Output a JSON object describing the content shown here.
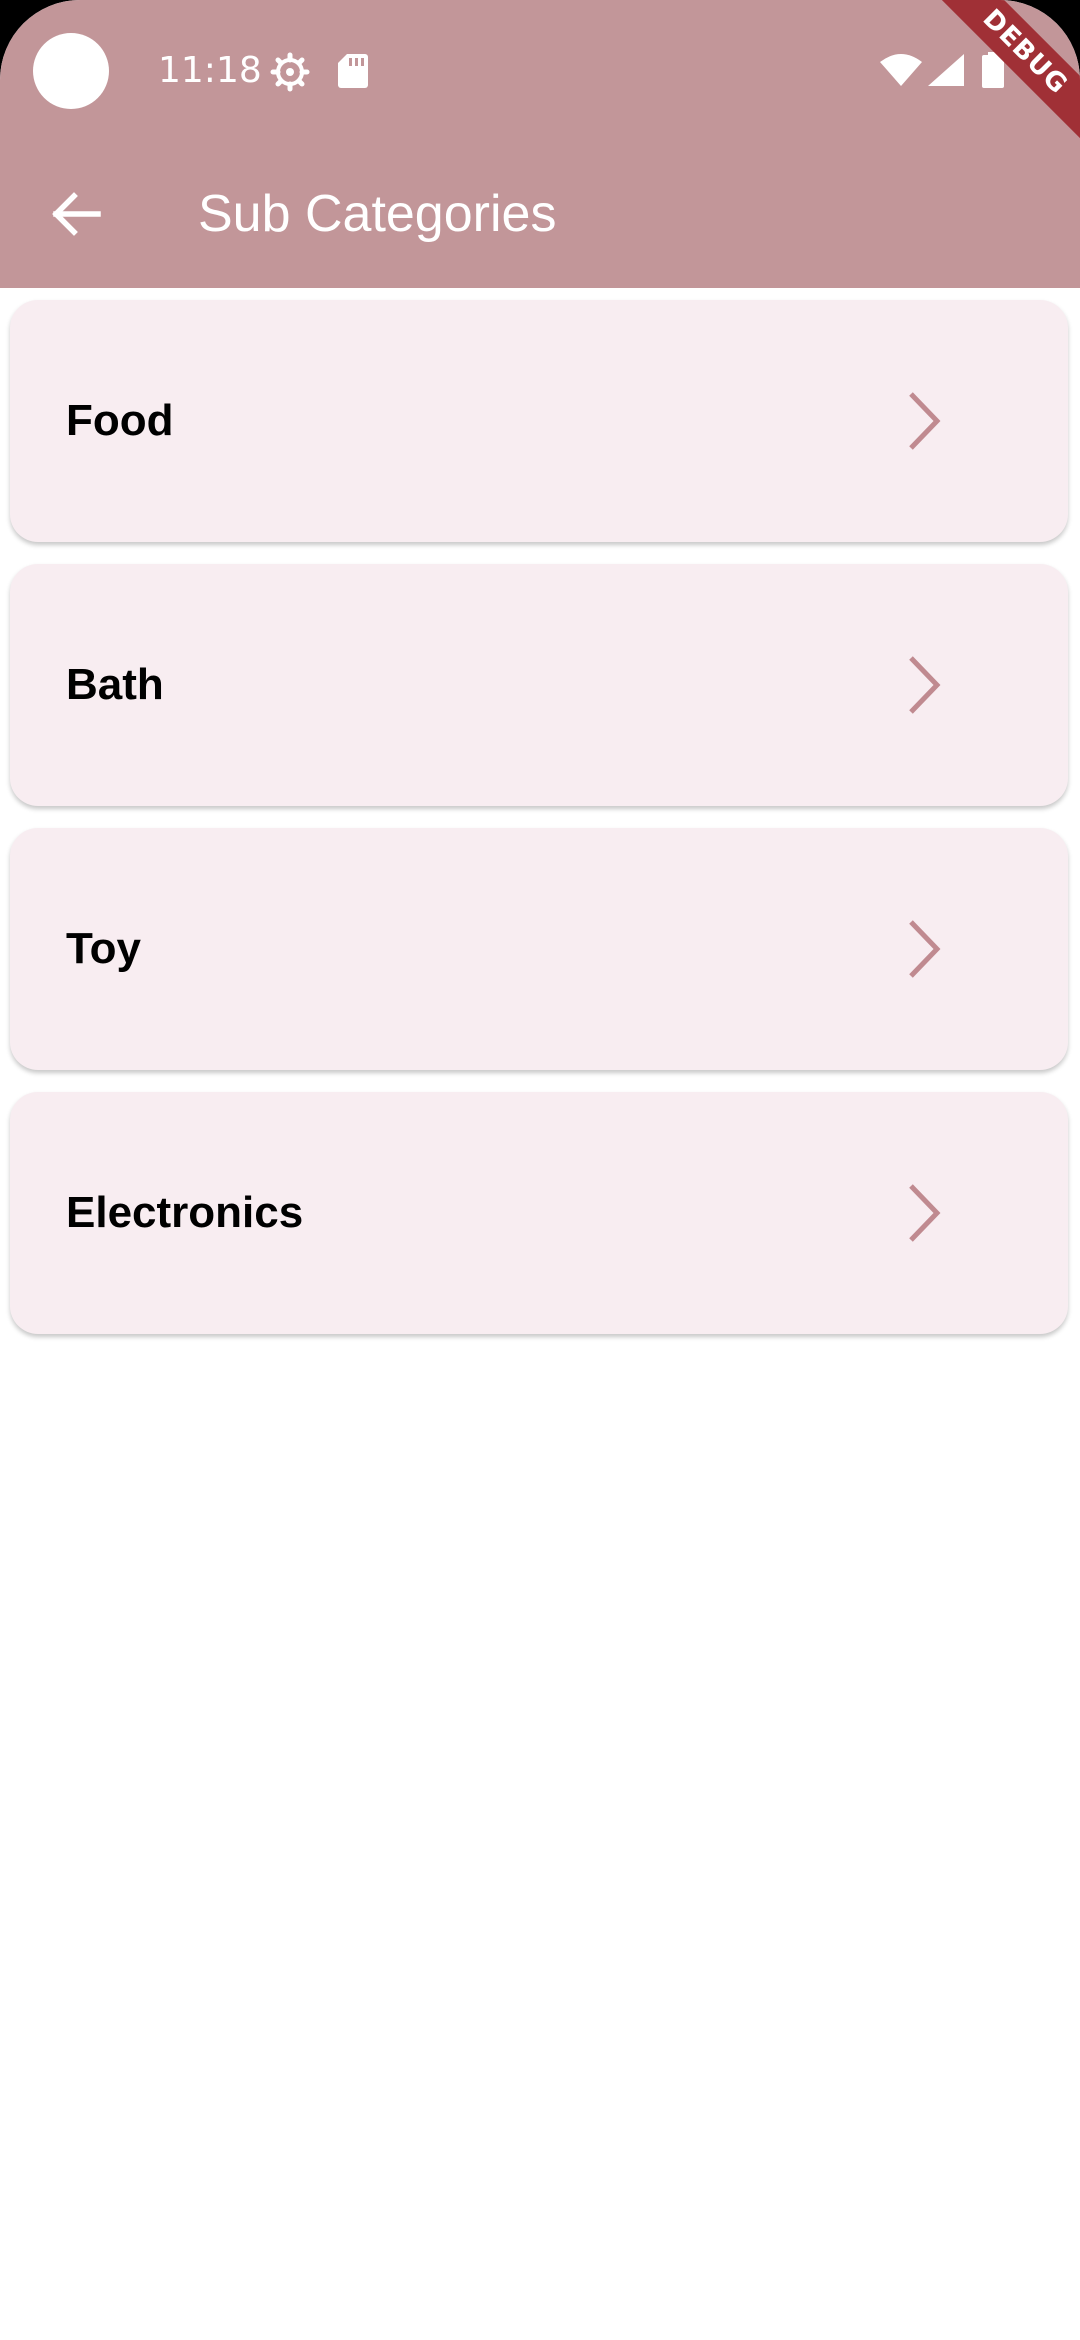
{
  "status_bar": {
    "time": "11:18"
  },
  "debug_banner": "DEBUG",
  "app_bar": {
    "title": "Sub Categories"
  },
  "categories": [
    {
      "label": "Food"
    },
    {
      "label": "Bath"
    },
    {
      "label": "Toy"
    },
    {
      "label": "Electronics"
    }
  ],
  "colors": {
    "app_bar": "#c29699",
    "card_background": "#f8edf1",
    "chevron": "#c08a90",
    "debug_banner": "#a03036"
  },
  "icons": {
    "back": "arrow-left-icon",
    "chevron": "chevron-right-icon",
    "status": [
      "settings-gear-icon",
      "sd-card-icon",
      "wifi-icon",
      "cell-signal-icon",
      "battery-icon"
    ]
  }
}
